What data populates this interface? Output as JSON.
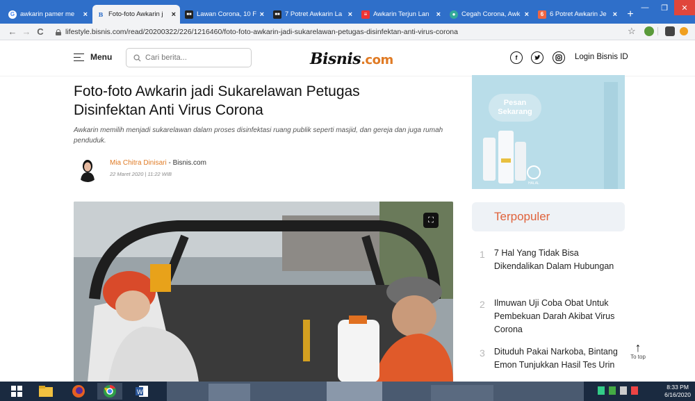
{
  "browser": {
    "tabs": [
      {
        "title": "awkarin pamer me",
        "favicon": "google-icon",
        "color": "#fff",
        "active": false
      },
      {
        "title": "Foto-foto Awkarin j",
        "favicon": "bisnis-icon",
        "color": "#2f6fc9",
        "active": true
      },
      {
        "title": "Lawan Corona, 10 F",
        "favicon": "news-icon",
        "color": "#222",
        "active": false
      },
      {
        "title": "7 Potret Awkarin La",
        "favicon": "news-icon",
        "color": "#222",
        "active": false
      },
      {
        "title": "Awkarin Terjun Lan",
        "favicon": "flag-icon",
        "color": "#e33",
        "active": false
      },
      {
        "title": "Cegah Corona, Awk",
        "favicon": "globe-icon",
        "color": "#3a9",
        "active": false
      },
      {
        "title": "6 Potret Awkarin Je",
        "favicon": "six-icon",
        "color": "#e64",
        "active": false
      }
    ],
    "url": "lifestyle.bisnis.com/read/20200322/226/1216460/foto-foto-awkarin-jadi-sukarelawan-petugas-disinfektan-anti-virus-corona"
  },
  "site": {
    "menu_label": "Menu",
    "search_placeholder": "Cari berita...",
    "logo_main": "Bisnis",
    "logo_suffix": ".com",
    "login_label": "Login Bisnis ID",
    "social": [
      "f",
      "t",
      "ig"
    ]
  },
  "article": {
    "title": "Foto-foto Awkarin jadi Sukarelawan Petugas Disinfektan Anti Virus Corona",
    "summary": "Awkarin memilih menjadi sukarelawan dalam proses disinfektasi ruang publik seperti masjid, dan gereja dan juga rumah penduduk.",
    "author_name": "Mia Chitra Dinisari",
    "author_source": " - Bisnis.com",
    "date": "22 Maret 2020  |  11:22 WIB"
  },
  "ad": {
    "button": "Pesan Sekarang",
    "brand": "HALAL"
  },
  "popular": {
    "heading": "Terpopuler",
    "items": [
      {
        "num": "1",
        "text": "7 Hal Yang Tidak Bisa Dikendalikan Dalam Hubungan"
      },
      {
        "num": "2",
        "text": "Ilmuwan Uji Coba Obat Untuk Pembekuan Darah Akibat Virus Corona"
      },
      {
        "num": "3",
        "text": "Dituduh Pakai Narkoba, Bintang Emon Tunjukkan Hasil Tes Urin"
      }
    ]
  },
  "to_top": "To top",
  "taskbar": {
    "time": "8:33 PM",
    "date": "6/16/2020"
  }
}
